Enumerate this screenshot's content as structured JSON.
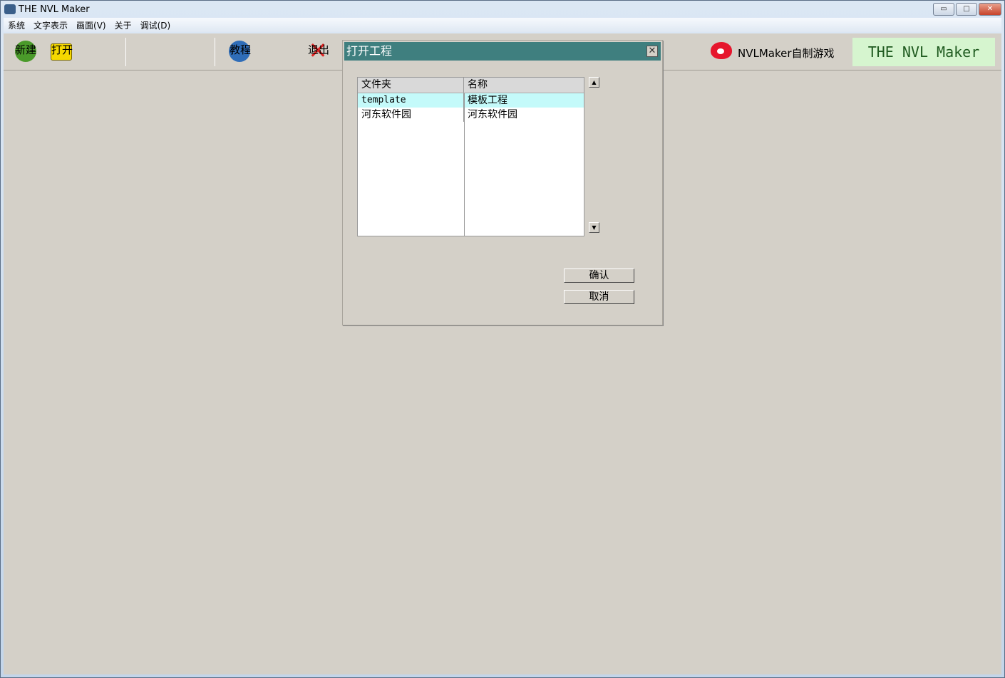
{
  "window": {
    "title": "THE NVL Maker",
    "controls": {
      "minimize": "▭",
      "maximize": "□",
      "close": "✕"
    }
  },
  "menu": [
    "系统",
    "文字表示",
    "画面(V)",
    "关于",
    "调试(D)"
  ],
  "toolbar": {
    "new": "新建",
    "open": "打开",
    "tutorial": "教程",
    "exit": "退出",
    "brand": "NVLMaker自制游戏",
    "logo": "THE NVL Maker"
  },
  "dialog": {
    "title": "打开工程",
    "close": "✕",
    "columns": [
      "文件夹",
      "名称"
    ],
    "rows": [
      {
        "folder": "template",
        "name": "模板工程",
        "selected": true
      },
      {
        "folder": "河东软件园",
        "name": "河东软件园",
        "selected": false
      }
    ],
    "scroll_up": "▲",
    "scroll_down": "▼",
    "confirm": "确认",
    "cancel": "取消"
  },
  "colors": {
    "dialog_title": "#3f7f7f",
    "selection": "#c4fafa",
    "background": "#d4d0c8"
  }
}
